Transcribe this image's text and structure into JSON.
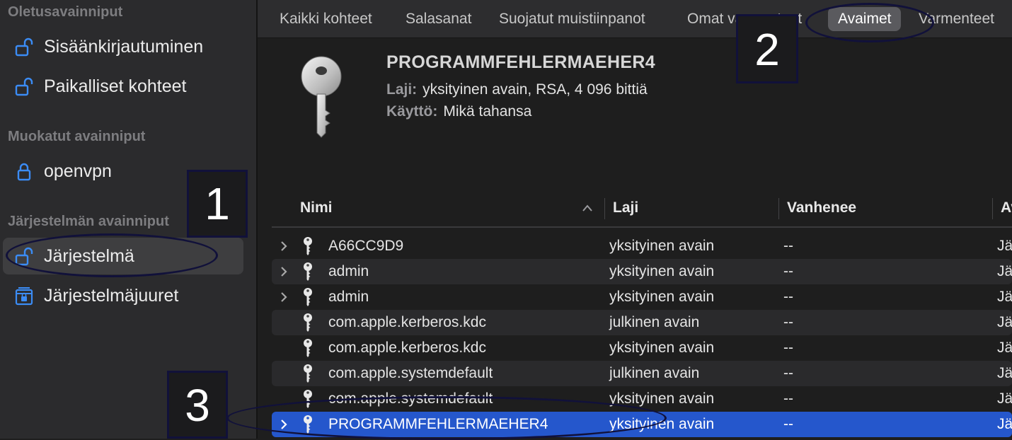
{
  "sidebar": {
    "sections": [
      {
        "title": "Oletusavainniput",
        "items": [
          {
            "label": "Sisäänkirjautuminen",
            "icon": "unlocked-lock-icon"
          },
          {
            "label": "Paikalliset kohteet",
            "icon": "unlocked-lock-icon"
          }
        ]
      },
      {
        "title": "Muokatut avainniput",
        "items": [
          {
            "label": "openvpn",
            "icon": "locked-lock-icon"
          }
        ]
      },
      {
        "title": "Järjestelmän avainniput",
        "items": [
          {
            "label": "Järjestelmä",
            "icon": "unlocked-lock-icon",
            "selected": true
          },
          {
            "label": "Järjestelmäjuuret",
            "icon": "cabinet-lock-icon"
          }
        ]
      }
    ]
  },
  "tabs": [
    {
      "label": "Kaikki kohteet"
    },
    {
      "label": "Salasanat"
    },
    {
      "label": "Suojatut muistiinpanot"
    },
    {
      "label": "Omat varmenteet"
    },
    {
      "label": "Avaimet",
      "active": true
    },
    {
      "label": "Varmenteet"
    }
  ],
  "detail": {
    "title": "PROGRAMMFEHLERMAEHER4",
    "kind_label": "Laji:",
    "kind_value": "yksityinen avain, RSA, 4 096 bittiä",
    "usage_label": "Käyttö:",
    "usage_value": "Mikä tahansa"
  },
  "table": {
    "columns": [
      "Nimi",
      "Laji",
      "Vanhenee",
      "Av"
    ],
    "rows": [
      {
        "name": "A66CC9D9",
        "kind": "yksityinen avain",
        "expires": "--",
        "extra": "Jä",
        "expandable": true
      },
      {
        "name": "admin",
        "kind": "yksityinen avain",
        "expires": "--",
        "extra": "Jä",
        "expandable": true
      },
      {
        "name": "admin",
        "kind": "yksityinen avain",
        "expires": "--",
        "extra": "Jä",
        "expandable": true
      },
      {
        "name": "com.apple.kerberos.kdc",
        "kind": "julkinen avain",
        "expires": "--",
        "extra": "Jä",
        "expandable": false
      },
      {
        "name": "com.apple.kerberos.kdc",
        "kind": "yksityinen avain",
        "expires": "--",
        "extra": "Jä",
        "expandable": false
      },
      {
        "name": "com.apple.systemdefault",
        "kind": "julkinen avain",
        "expires": "--",
        "extra": "Jä",
        "expandable": false
      },
      {
        "name": "com.apple.systemdefault",
        "kind": "yksityinen avain",
        "expires": "--",
        "extra": "Jä",
        "expandable": false
      },
      {
        "name": "PROGRAMMFEHLERMAEHER4",
        "kind": "yksityinen avain",
        "expires": "--",
        "extra": "Jä",
        "expandable": true,
        "selected": true
      }
    ]
  },
  "annotations": {
    "one": "1",
    "two": "2",
    "three": "3"
  },
  "colors": {
    "accent": "#2557cc",
    "lock_icon": "#3b8cf5",
    "annotation": "#11113a"
  }
}
